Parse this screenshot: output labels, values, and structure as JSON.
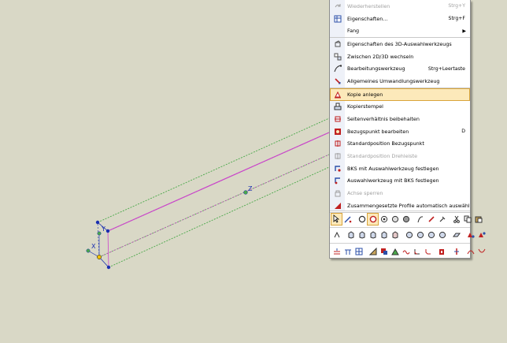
{
  "viewport": {
    "axis_labels": {
      "y": "Y",
      "x": "X",
      "z": "Z"
    },
    "colors": {
      "background": "#d9d8c6",
      "profile_lines": "#4aa84a",
      "axis_line": "#cc44cc",
      "points": "#1a2fb0",
      "active_point": "#f0c000"
    }
  },
  "menu": {
    "items": [
      {
        "label": "Wiederherstellen",
        "shortcut": "Strg+Y",
        "icon": "redo-icon",
        "disabled": true
      },
      {
        "label": "Eigenschaften...",
        "shortcut": "Strg+F",
        "icon": "properties-icon"
      },
      {
        "label": "Fang",
        "submenu": true,
        "icon": ""
      },
      {
        "label": "Eigenschaften des 3D-Auswahlwerkzeugs",
        "icon": "3d-tool-properties-icon"
      },
      {
        "label": "Zwischen 2D/3D wechseln",
        "icon": "toggle-2d-3d-icon"
      },
      {
        "label": "Bearbeitungswerkzeug",
        "shortcut": "Strg+Leertaste",
        "icon": "edit-tool-icon"
      },
      {
        "label": "Allgemeines Umwandlungswerkzeug",
        "icon": "transform-tool-icon"
      },
      {
        "label": "Kopie anlegen",
        "icon": "create-copy-icon",
        "selected": true
      },
      {
        "label": "Kopierstempel",
        "icon": "copy-stamp-icon"
      },
      {
        "label": "Seitenverhältnis beibehalten",
        "icon": "aspect-ratio-icon"
      },
      {
        "label": "Bezugspunkt bearbeiten",
        "shortcut": "D",
        "icon": "reference-point-icon"
      },
      {
        "label": "Standardposition Bezugspunkt",
        "icon": "default-reference-icon"
      },
      {
        "label": "Standardposition Drehleiste",
        "icon": "default-rotation-bar-icon",
        "disabled": true
      },
      {
        "label": "BKS mit Auswahlwerkzeug festlegen",
        "icon": "set-ucs-icon"
      },
      {
        "label": "Auswahlwerkzeug mit BKS festlegen",
        "icon": "set-tool-ucs-icon"
      },
      {
        "label": "Achse sperren",
        "icon": "lock-axis-icon",
        "disabled": true
      },
      {
        "label": "Zusammengesetzte Profile automatisch auswählen",
        "icon": "auto-select-profiles-icon"
      }
    ]
  },
  "toolbars": {
    "row1": [
      "pointer-icon",
      "pen-icon",
      "object-mode-icon",
      "selected-mode-icon",
      "mode-icon",
      "mode2-icon",
      "mode3-icon",
      "fx-icon",
      "brush-icon",
      "eyedropper-icon",
      "cut-icon",
      "copy-icon",
      "paste-icon"
    ],
    "row2": [
      "tool1-icon",
      "cube1-icon",
      "cube2-icon",
      "cube3-icon",
      "cube4-icon",
      "cube5-icon",
      "sphere1-icon",
      "sphere2-icon",
      "sphere3-icon",
      "sphere4-icon",
      "plane-icon",
      "shapes1-icon",
      "shapes2-icon"
    ],
    "row3": [
      "extrude-icon",
      "loft-icon",
      "grid-icon",
      "boolean1-icon",
      "boolean2-icon",
      "boolean3-icon",
      "wave-icon",
      "fillet-icon",
      "chamfer-icon",
      "shell-icon",
      "split-icon",
      "curve1-icon",
      "curve2-icon"
    ]
  }
}
